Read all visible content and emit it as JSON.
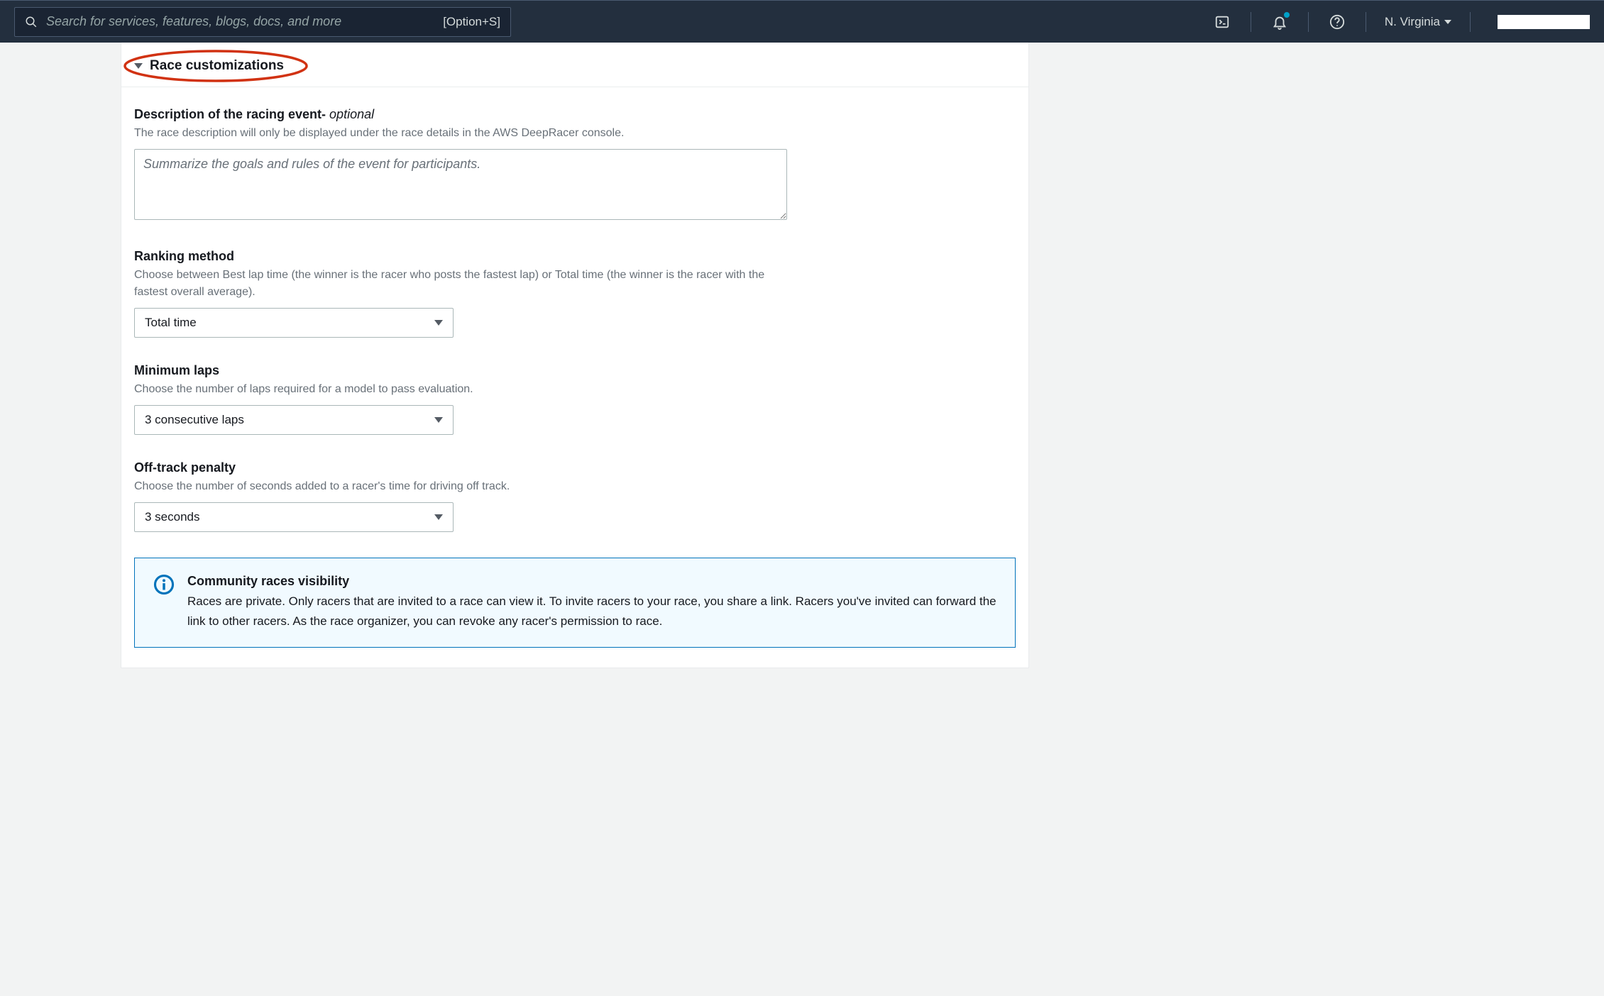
{
  "nav": {
    "search_placeholder": "Search for services, features, blogs, docs, and more",
    "search_hint": "[Option+S]",
    "region": "N. Virginia"
  },
  "section": {
    "title": "Race customizations"
  },
  "description_field": {
    "label": "Description of the racing event-",
    "optional": " optional",
    "help": "The race description will only be displayed under the race details in the AWS DeepRacer console.",
    "placeholder": "Summarize the goals and rules of the event for participants."
  },
  "ranking_field": {
    "label": "Ranking method",
    "help": "Choose between Best lap time (the winner is the racer who posts the fastest lap) or Total time (the winner is the racer with the fastest overall average).",
    "value": "Total time"
  },
  "minlaps_field": {
    "label": "Minimum laps",
    "help": "Choose the number of laps required for a model to pass evaluation.",
    "value": "3 consecutive laps"
  },
  "penalty_field": {
    "label": "Off-track penalty",
    "help": "Choose the number of seconds added to a racer's time for driving off track.",
    "value": "3 seconds"
  },
  "info": {
    "title": "Community races visibility",
    "text": "Races are private. Only racers that are invited to a race can view it. To invite racers to your race, you share a link. Racers you've invited can forward the link to other racers. As the race organizer, you can revoke any racer's permission to race."
  }
}
